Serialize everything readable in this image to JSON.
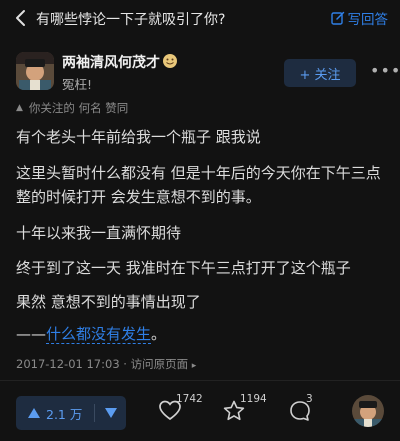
{
  "topbar": {
    "title": "有哪些悖论一下子就吸引了你?",
    "write_answer": "写回答"
  },
  "author": {
    "name": "两袖清风何茂才",
    "bio": "冤枉!",
    "follow_label": "+ 关注"
  },
  "social_note": {
    "text": "你关注的 何名 赞同"
  },
  "answer": {
    "p1": "有个老头十年前给我一个瓶子 跟我说",
    "p2": "这里头暂时什么都没有 但是十年后的今天你在下午三点整的时候打开 会发生意想不到的事。",
    "p3": "十年以来我一直满怀期待",
    "p4": "终于到了这一天 我准时在下午三点打开了这个瓶子",
    "p5": "果然 意想不到的事情出现了",
    "p6_dash": "——",
    "p6_link": "什么都没有发生",
    "p6_end": "。"
  },
  "meta": {
    "date": "2017-12-01 17:03",
    "view_original": "访问原页面"
  },
  "footer": {
    "vote_count": "2.1 万",
    "like_count": "1742",
    "fav_count": "1194",
    "comment_count": "3"
  },
  "colors": {
    "background": "#121212",
    "accent": "#2f7fe6",
    "pill": "#1e2c40"
  }
}
